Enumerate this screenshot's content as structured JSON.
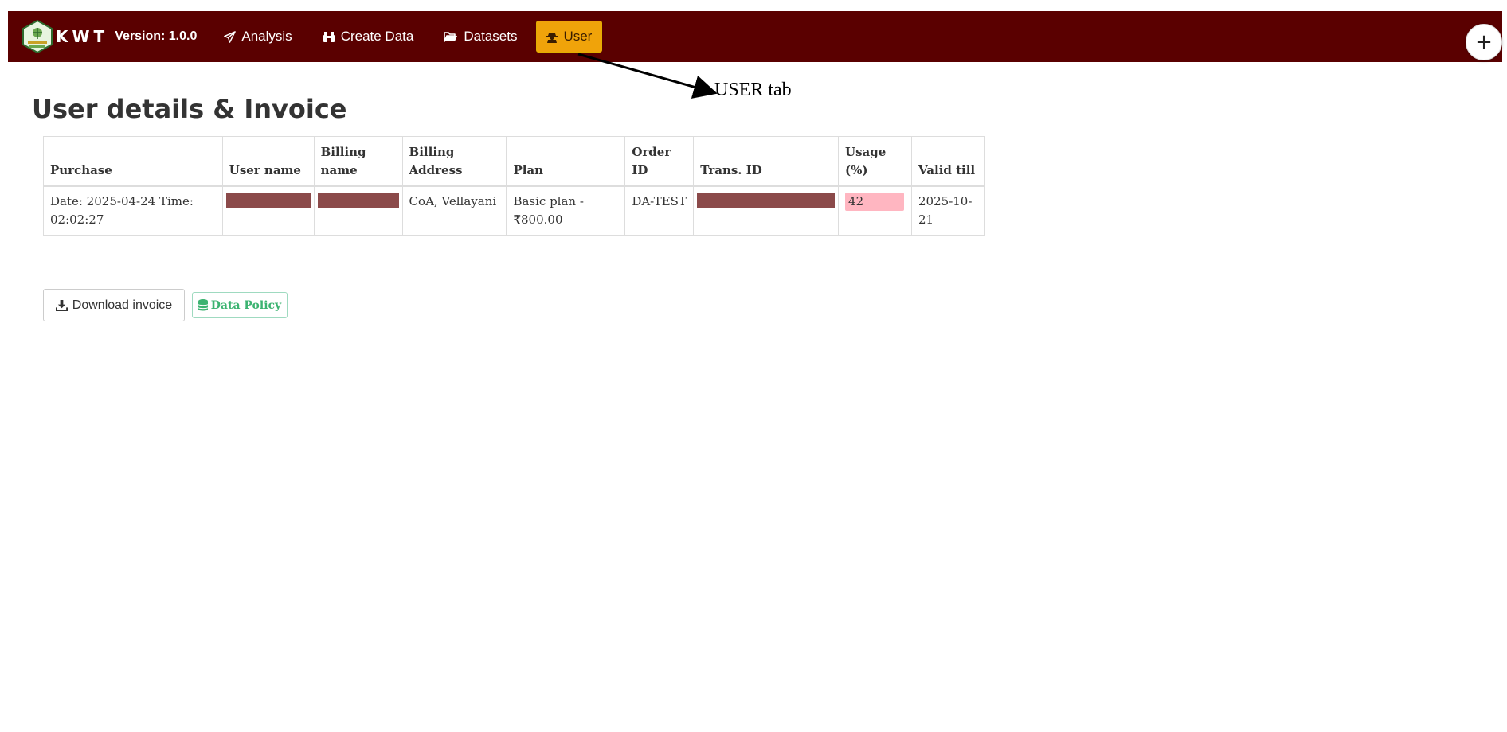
{
  "navbar": {
    "brand": "KWT",
    "version": "Version: 1.0.0",
    "items": [
      {
        "label": "Analysis",
        "icon": "paper-plane-icon"
      },
      {
        "label": "Create Data",
        "icon": "binoculars-icon"
      },
      {
        "label": "Datasets",
        "icon": "folder-open-icon"
      },
      {
        "label": "User",
        "icon": "user-secret-icon",
        "active": true
      }
    ],
    "plus": "+"
  },
  "annotation": {
    "text": "USER tab"
  },
  "page": {
    "title": "User details & Invoice"
  },
  "table": {
    "headers": [
      "Purchase",
      "User name",
      "Billing name",
      "Billing Address",
      "Plan",
      "Order ID",
      "Trans. ID",
      "Usage (%)",
      "Valid till"
    ],
    "row": {
      "purchase": "Date: 2025-04-24 Time: 02:02:27",
      "billing_address": "CoA, Vellayani",
      "plan": "Basic plan - ₹800.00",
      "order_id": "DA-TEST",
      "usage": "42",
      "valid_till": "2025-10-21"
    }
  },
  "buttons": {
    "download": "Download invoice",
    "policy": "Data Policy"
  },
  "colors": {
    "navbar_bg": "#5a0000",
    "active_tab": "#f0a30a",
    "redaction": "#8b4a4a",
    "usage_badge": "#ffb6c1",
    "policy_green": "#3cb371"
  }
}
